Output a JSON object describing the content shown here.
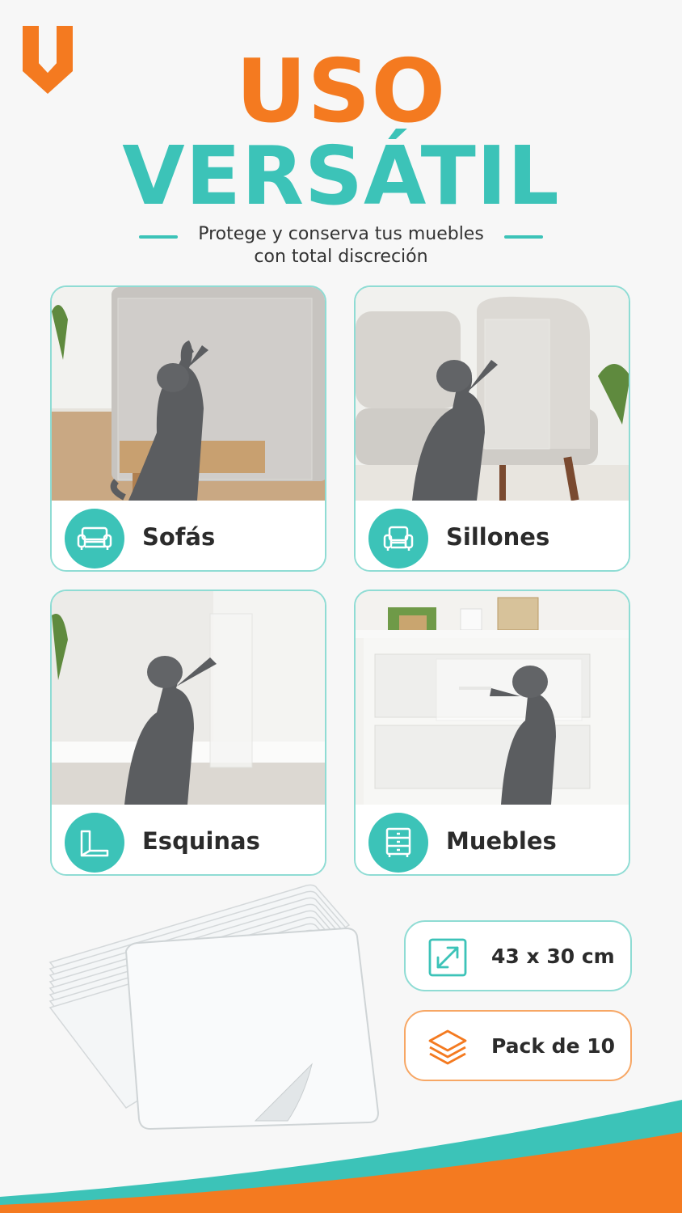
{
  "brand": {
    "accent": "#f47a20",
    "teal": "#3cc3b8",
    "logo_icon": "brand-shield-v-logo"
  },
  "hero": {
    "title_line1": "USO",
    "title_line2": "VERSÁTIL",
    "subtitle_line1": "Protege y conserva tus muebles",
    "subtitle_line2": "con total discreción"
  },
  "cards": [
    {
      "label": "Sofás",
      "icon": "sofa-icon",
      "photo": "cat scratching sofa side with clear protector"
    },
    {
      "label": "Sillones",
      "icon": "armchair-icon",
      "photo": "cat scratching armchair with clear protector"
    },
    {
      "label": "Esquinas",
      "icon": "corner-guard-icon",
      "photo": "cat scratching wall corner with clear protector"
    },
    {
      "label": "Muebles",
      "icon": "cabinet-icon",
      "photo": "cat scratching dresser drawer with clear protector"
    }
  ],
  "specs": {
    "size": {
      "text": "43 x 30 cm",
      "icon": "resize-arrows-icon",
      "color": "#3cc3b8"
    },
    "pack": {
      "text": "Pack de 10",
      "icon": "layers-icon",
      "color": "#f47a20"
    }
  }
}
